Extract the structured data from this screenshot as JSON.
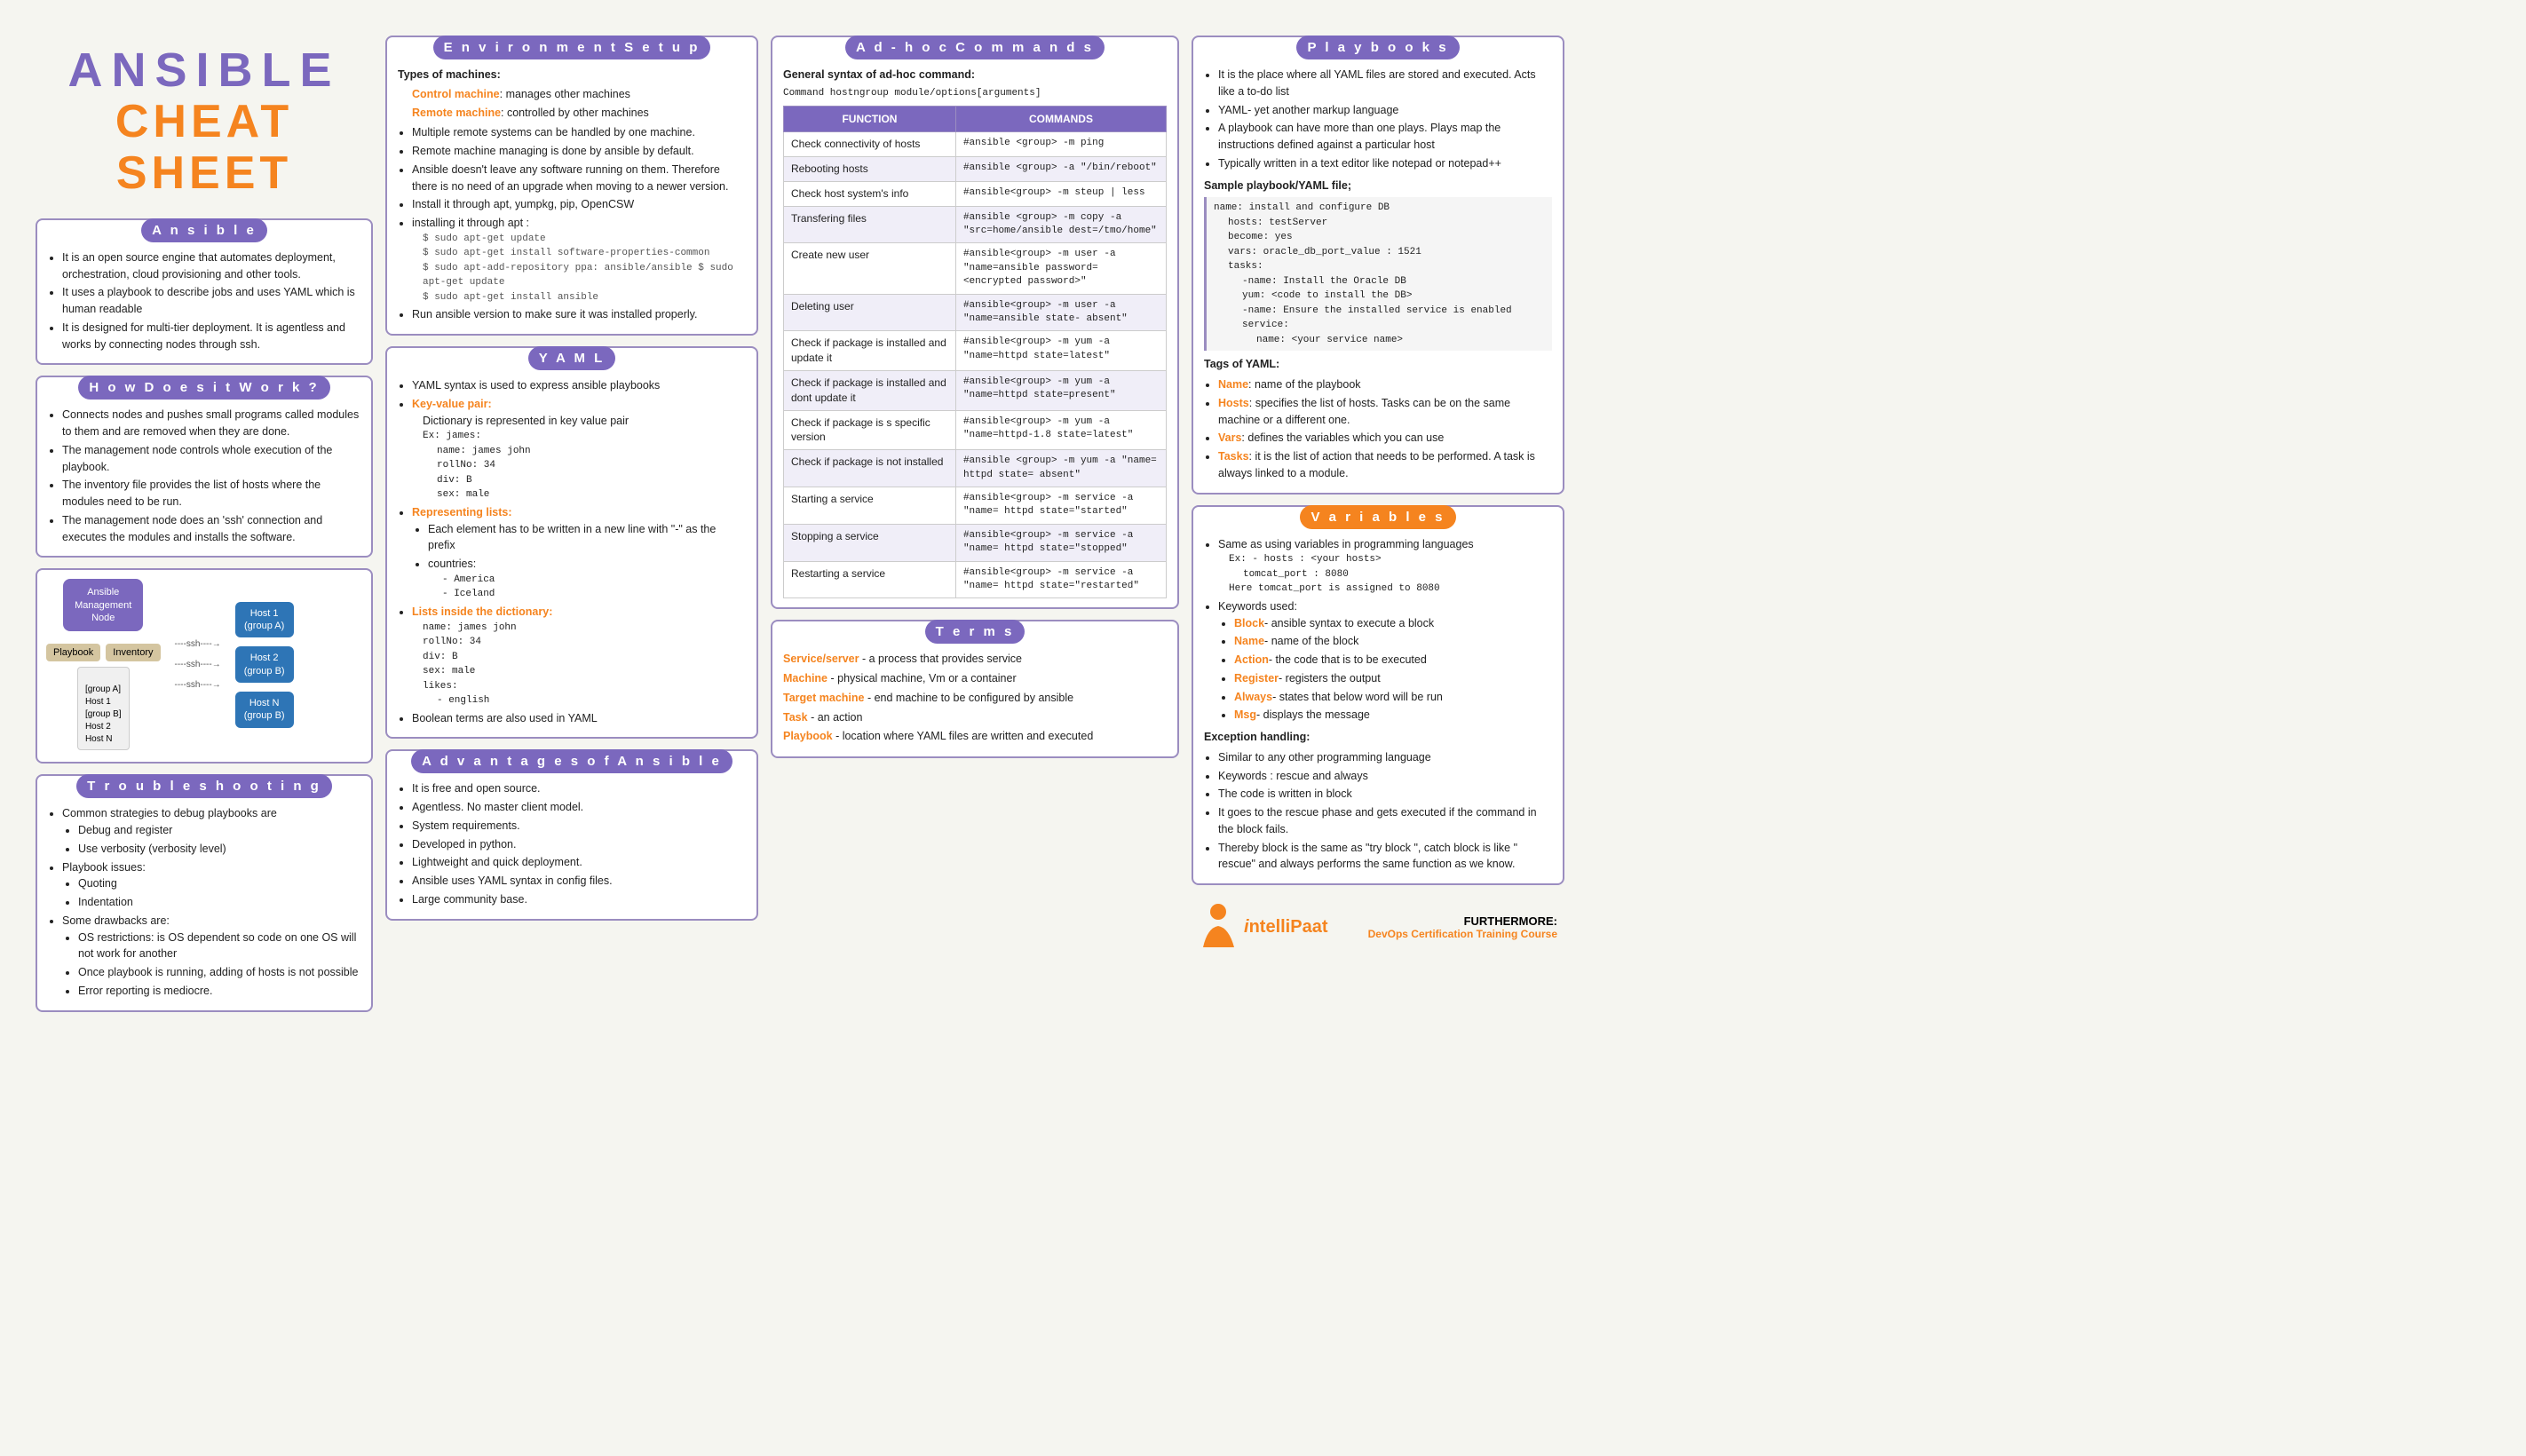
{
  "title": {
    "ansible": "ANSIBLE",
    "cheatsheet": "CHEAT SHEET"
  },
  "ansible_section": {
    "title": "A n s i b l e",
    "points": [
      "It is an open source engine that automates deployment, orchestration, cloud provisioning and other tools.",
      "It uses a playbook to describe jobs and uses YAML which is human readable",
      "It is designed for multi-tier deployment. It is agentless and works by connecting nodes through ssh."
    ]
  },
  "how_works": {
    "title": "H o w   D o e s   i t   W o r k ?",
    "points": [
      "Connects nodes and pushes small programs called modules to them and are removed when they are done.",
      "The management node controls whole execution of the playbook.",
      "The inventory file provides the list of hosts where the modules need to be run.",
      "The management node does an 'ssh' connection and executes the modules and installs the software."
    ]
  },
  "troubleshooting": {
    "title": "T r o u b l e s h o o t i n g",
    "content": [
      "Common strategies to debug playbooks are",
      "Debug and register",
      "Use verbosity (verbosity level)",
      "Playbook issues:",
      "Quoting",
      "Indentation",
      "Some drawbacks are:",
      "OS restrictions: is OS dependent so code on one OS will not work for another",
      "Once playbook is running, adding of hosts is not possible",
      "Error reporting is mediocre."
    ]
  },
  "environment_setup": {
    "title": "E n v i r o n m e n t   S e t u p",
    "types_label": "Types of machines:",
    "control": "Control machine",
    "control_desc": ": manages other machines",
    "remote": "Remote machine",
    "remote_desc": ": controlled by other machines",
    "points": [
      "Multiple remote systems can be handled by one machine.",
      "Remote machine managing is done by ansible by default.",
      "Ansible doesn't leave any software running on them. Therefore there is no need of an upgrade when moving to a newer version.",
      "Install it through apt, yumpkg, pip, OpenCSW",
      "installing it through apt :",
      "$ sudo apt-get update",
      "$ sudo apt-get install software-properties-common",
      "$ sudo apt-add-repository ppa: ansible/ansible $ sudo apt-get update",
      "$ sudo apt-get install ansible",
      "Run ansible version to make sure it was installed properly."
    ]
  },
  "yaml": {
    "title": "Y A M L",
    "intro": "YAML syntax is used to express ansible playbooks",
    "key_value_label": "Key-value pair:",
    "key_value_desc": "Dictionary is represented in key value pair",
    "kv_example": "Ex: james:",
    "kv_lines": [
      "name: james john",
      "rollNo: 34",
      "div: B",
      "sex: male"
    ],
    "lists_label": "Representing lists:",
    "lists_points": [
      "Each element has to be written in a new line with \"-\" as the prefix",
      "countries:"
    ],
    "countries": [
      "- America",
      "- Iceland"
    ],
    "lists_dict_label": "Lists inside the dictionary:",
    "lists_dict_example": [
      "name: james john",
      "rollNo: 34",
      "div: B",
      "sex: male",
      "likes:",
      "- english"
    ],
    "boolean_note": "Boolean terms are also used in YAML"
  },
  "advantages": {
    "title": "A d v a n t a g e s   o f   A n s i b l e",
    "points": [
      "It is free and open source.",
      "Agentless. No master client model.",
      "System requirements.",
      "Developed in python.",
      "Lightweight and quick deployment.",
      "Ansible uses YAML syntax in config files.",
      "Large community base."
    ]
  },
  "adhoc": {
    "title": "A d - h o c   C o m m a n d s",
    "syntax_label": "General syntax of ad-hoc command:",
    "syntax": "Command hostngroup module/options[arguments]",
    "columns": [
      "FUNCTION",
      "COMMANDS"
    ],
    "rows": [
      {
        "function": "Check connectivity of hosts",
        "command": "#ansible <group> -m ping"
      },
      {
        "function": "Rebooting hosts",
        "command": "#ansible <group> -a \"/bin/reboot\""
      },
      {
        "function": "Check host system's info",
        "command": "#ansible<group> -m steup | less"
      },
      {
        "function": "Transfering files",
        "command": "#ansible <group> -m copy -a \"src=home/ansible dest=/tmo/home\""
      },
      {
        "function": "Create new user",
        "command": "#ansible<group> -m user -a \"name=ansible password= <encrypted password>\""
      },
      {
        "function": "Deleting user",
        "command": "#ansible<group> -m user -a \"name=ansible state- absent\""
      },
      {
        "function": "Check if package is installed and update it",
        "command": "#ansible<group> -m yum -a \"name=httpd state=latest\""
      },
      {
        "function": "Check if package is installed and dont update it",
        "command": "#ansible<group> -m yum -a \"name=httpd state=present\""
      },
      {
        "function": "Check if package is s specific version",
        "command": "#ansible<group> -m yum -a \"name=httpd-1.8 state=latest\""
      },
      {
        "function": "Check if package is not installed",
        "command": "#ansible <group> -m yum -a \"name= httpd state= absent\""
      },
      {
        "function": "Starting a service",
        "command": "#ansible<group> -m service -a \"name= httpd state=\"started\""
      },
      {
        "function": "Stopping a service",
        "command": "#ansible<group> -m service -a \"name= httpd state=\"stopped\""
      },
      {
        "function": "Restarting a service",
        "command": "#ansible<group> -m service -a \"name= httpd state=\"restarted\""
      }
    ]
  },
  "terms": {
    "title": "T e r m s",
    "items": [
      {
        "label": "Service/server",
        "color": "orange",
        "desc": "a process that provides service"
      },
      {
        "label": "Machine",
        "color": "orange",
        "desc": "physical machine, Vm or a container"
      },
      {
        "label": "Target machine",
        "color": "orange",
        "desc": "end machine to be configured by ansible"
      },
      {
        "label": "Task",
        "color": "orange",
        "desc": "an action"
      },
      {
        "label": "Playbook",
        "color": "orange",
        "desc": "location where YAML files are written and executed"
      }
    ]
  },
  "playbooks": {
    "title": "P l a y b o o k s",
    "points": [
      "It is the place where all YAML files are stored and executed. Acts like a to-do list",
      "YAML- yet another markup language",
      "A playbook can have more than one plays. Plays map the instructions defined against a particular host",
      "Typically written in a text editor like notepad or notepad++"
    ],
    "sample_label": "Sample playbook/YAML file;",
    "code_lines": [
      "name: install and configure DB",
      "hosts: testServer",
      "become: yes",
      "vars: oracle_db_port_value : 1521",
      "tasks:",
      "-name: Install the Oracle DB",
      "yum: <code to install the DB>",
      "-name: Ensure the installed service is enabled",
      "service:",
      "name: <your service name>"
    ],
    "tags_label": "Tags of YAML:",
    "tags": [
      {
        "label": "Name",
        "color": "orange",
        "desc": "name of the playbook"
      },
      {
        "label": "Hosts",
        "color": "orange",
        "desc": "specifies the list of hosts. Tasks can be on the same machine or a different one."
      },
      {
        "label": "Vars",
        "color": "orange",
        "desc": "defines the variables which you can use"
      },
      {
        "label": "Tasks",
        "color": "orange",
        "desc": "it is the list of action that needs to be performed. A task is always linked to a module."
      }
    ]
  },
  "variables": {
    "title": "V a r i a b l e s",
    "intro": "Same as using variables in programming languages",
    "examples": [
      "Ex: - hosts : <your hosts>",
      "tomcat_port : 8080",
      "Here tomcat_port is assigned to 8080"
    ],
    "keywords_label": "Keywords used:",
    "keywords": [
      {
        "label": "Block",
        "color": "orange",
        "desc": "ansible syntax to execute a block"
      },
      {
        "label": "Name",
        "color": "orange",
        "desc": "name of the block"
      },
      {
        "label": "Action",
        "color": "orange",
        "desc": "the code that is to be executed"
      },
      {
        "label": "Register",
        "color": "orange",
        "desc": "registers the output"
      },
      {
        "label": "Always",
        "color": "orange",
        "desc": "states that below word will be run"
      },
      {
        "label": "Msg",
        "color": "orange",
        "desc": "displays the message"
      }
    ],
    "exception_label": "Exception handling:",
    "exception_points": [
      "Similar to any other programming language",
      "Keywords : rescue and always",
      "The code is written in block",
      "It goes to the rescue phase and gets executed if the command in the block fails.",
      "Thereby block is the same as \"try block \", catch block is like \" rescue\" and always performs the same function as we know."
    ]
  },
  "intellipaat": {
    "intelli": "ntelliPaat",
    "furthermore": "FURTHERMORE:",
    "course": "DevOps Certification Training Course"
  },
  "diagram": {
    "management_node": "Ansible\nManagement\nNode",
    "host1": "Host 1\n(group A)",
    "host2": "Host 2\n(group B)",
    "hostn": "Host N\n(group B)",
    "playbook": "Playbook",
    "inventory": "Inventory",
    "inventory_content": "[group A]\nHost 1\n[group B]\nHost 2\nHost N"
  }
}
